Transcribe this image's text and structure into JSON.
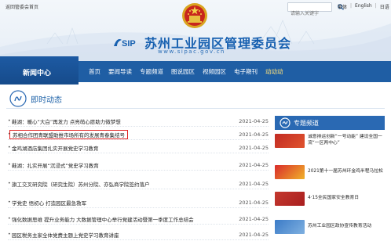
{
  "topbar": {
    "home_link": "返回管委会首页",
    "search_placeholder": "请输入关键字",
    "util_links": [
      "繁体",
      "English",
      "日语"
    ]
  },
  "header": {
    "site_title": "苏州工业园区管理委员会",
    "logo_text": "SIP",
    "site_url": "www.sipac.gov.cn"
  },
  "nav": {
    "home_label": "新闻中心",
    "items": [
      "首页",
      "要闻导读",
      "专题频道",
      "图说园区",
      "视频园区",
      "电子期刊",
      "动动动"
    ]
  },
  "section": {
    "title": "即时动态"
  },
  "news": [
    {
      "title": "鞋湖：暖心“大白”再发力 点亮萌心愿助力微梦想",
      "date": "2021-04-25"
    },
    {
      "title": "苏相合作团青联盟助推市场所有的发展青春集结号",
      "date": "2021-04-25"
    },
    {
      "title": "金鸡湖酒店集团扎实开展党史学习教育",
      "date": "2021-04-25"
    },
    {
      "title": "鞋湖：扎实开展“沉浸式”党史学习教育",
      "date": "2021-04-25"
    },
    {
      "title": "旗工交叉研究院（研究生院）苏州分院、亦弘商学院签约落户",
      "date": "2021-04-25"
    },
    {
      "title": "学党史 悟初心 打造园区最急救军",
      "date": "2021-04-25"
    },
    {
      "title": "强化数据思维 提升业务能力 大数据管理中心举行党建活动暨第一季度工作总结会",
      "date": "2021-04-25"
    },
    {
      "title": "园区税务主家全体党费主题上党史学习教育讲座",
      "date": "2021-04-25"
    }
  ],
  "sidebar": {
    "header_title": "专题频道",
    "items": [
      {
        "text": "诚意排运创新“一号动能” 建设全国一流“一区两中心”"
      },
      {
        "text": "2021第十一届苏州环金鸡半程马拉松"
      },
      {
        "text": "4·15全民国家安全教育日"
      },
      {
        "text": "苏州工业园区政协宣传教育活动"
      }
    ]
  },
  "colors": {
    "brand_blue": "#1f5ea4",
    "highlight_border": "#e02020",
    "title_blue": "#1760b0"
  }
}
